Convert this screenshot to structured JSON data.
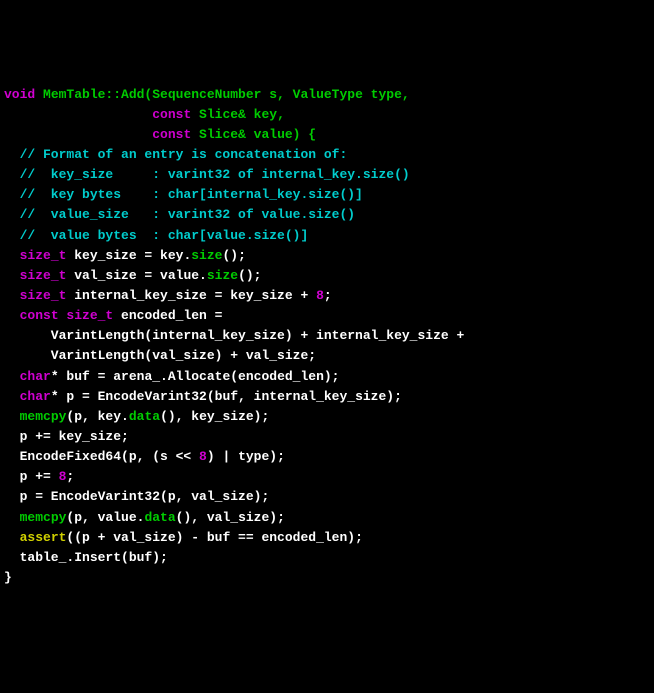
{
  "code": {
    "l1a": "void",
    "l1b": " MemTable::Add(SequenceNumber s, ValueType type,",
    "l2a": "                   ",
    "l2b": "const",
    "l2c": " Slice& key,",
    "l3a": "                   ",
    "l3b": "const",
    "l3c": " Slice& value) {",
    "l4": "  // Format of an entry is concatenation of:",
    "l5": "  //  key_size     : varint32 of internal_key.size()",
    "l6": "  //  key bytes    : char[internal_key.size()]",
    "l7": "  //  value_size   : varint32 of value.size()",
    "l8": "  //  value bytes  : char[value.size()]",
    "l9a": "  ",
    "l9b": "size_t",
    "l9c": " key_size = key.",
    "l9d": "size",
    "l9e": "();",
    "l10a": "  ",
    "l10b": "size_t",
    "l10c": " val_size = value.",
    "l10d": "size",
    "l10e": "();",
    "l11a": "  ",
    "l11b": "size_t",
    "l11c": " internal_key_size = key_size + ",
    "l11d": "8",
    "l11e": ";",
    "l12a": "  ",
    "l12b": "const size_t",
    "l12c": " encoded_len =",
    "l13": "      VarintLength(internal_key_size) + internal_key_size +",
    "l14": "      VarintLength(val_size) + val_size;",
    "l15a": "  ",
    "l15b": "char",
    "l15c": "* buf = arena_.Allocate(encoded_len);",
    "l16a": "  ",
    "l16b": "char",
    "l16c": "* p = EncodeVarint32(buf, internal_key_size);",
    "l17a": "  ",
    "l17b": "memcpy",
    "l17c": "(p, key.",
    "l17d": "data",
    "l17e": "(), key_size);",
    "l18": "  p += key_size;",
    "l19a": "  EncodeFixed64(p, (s << ",
    "l19b": "8",
    "l19c": ") | type);",
    "l20a": "  p += ",
    "l20b": "8",
    "l20c": ";",
    "l21": "  p = EncodeVarint32(p, val_size);",
    "l22a": "  ",
    "l22b": "memcpy",
    "l22c": "(p, value.",
    "l22d": "data",
    "l22e": "(), val_size);",
    "l23a": "  ",
    "l23b": "assert",
    "l23c": "((p + val_size) - buf == encoded_len);",
    "l24": "  table_.Insert(buf);",
    "l25": "}"
  }
}
